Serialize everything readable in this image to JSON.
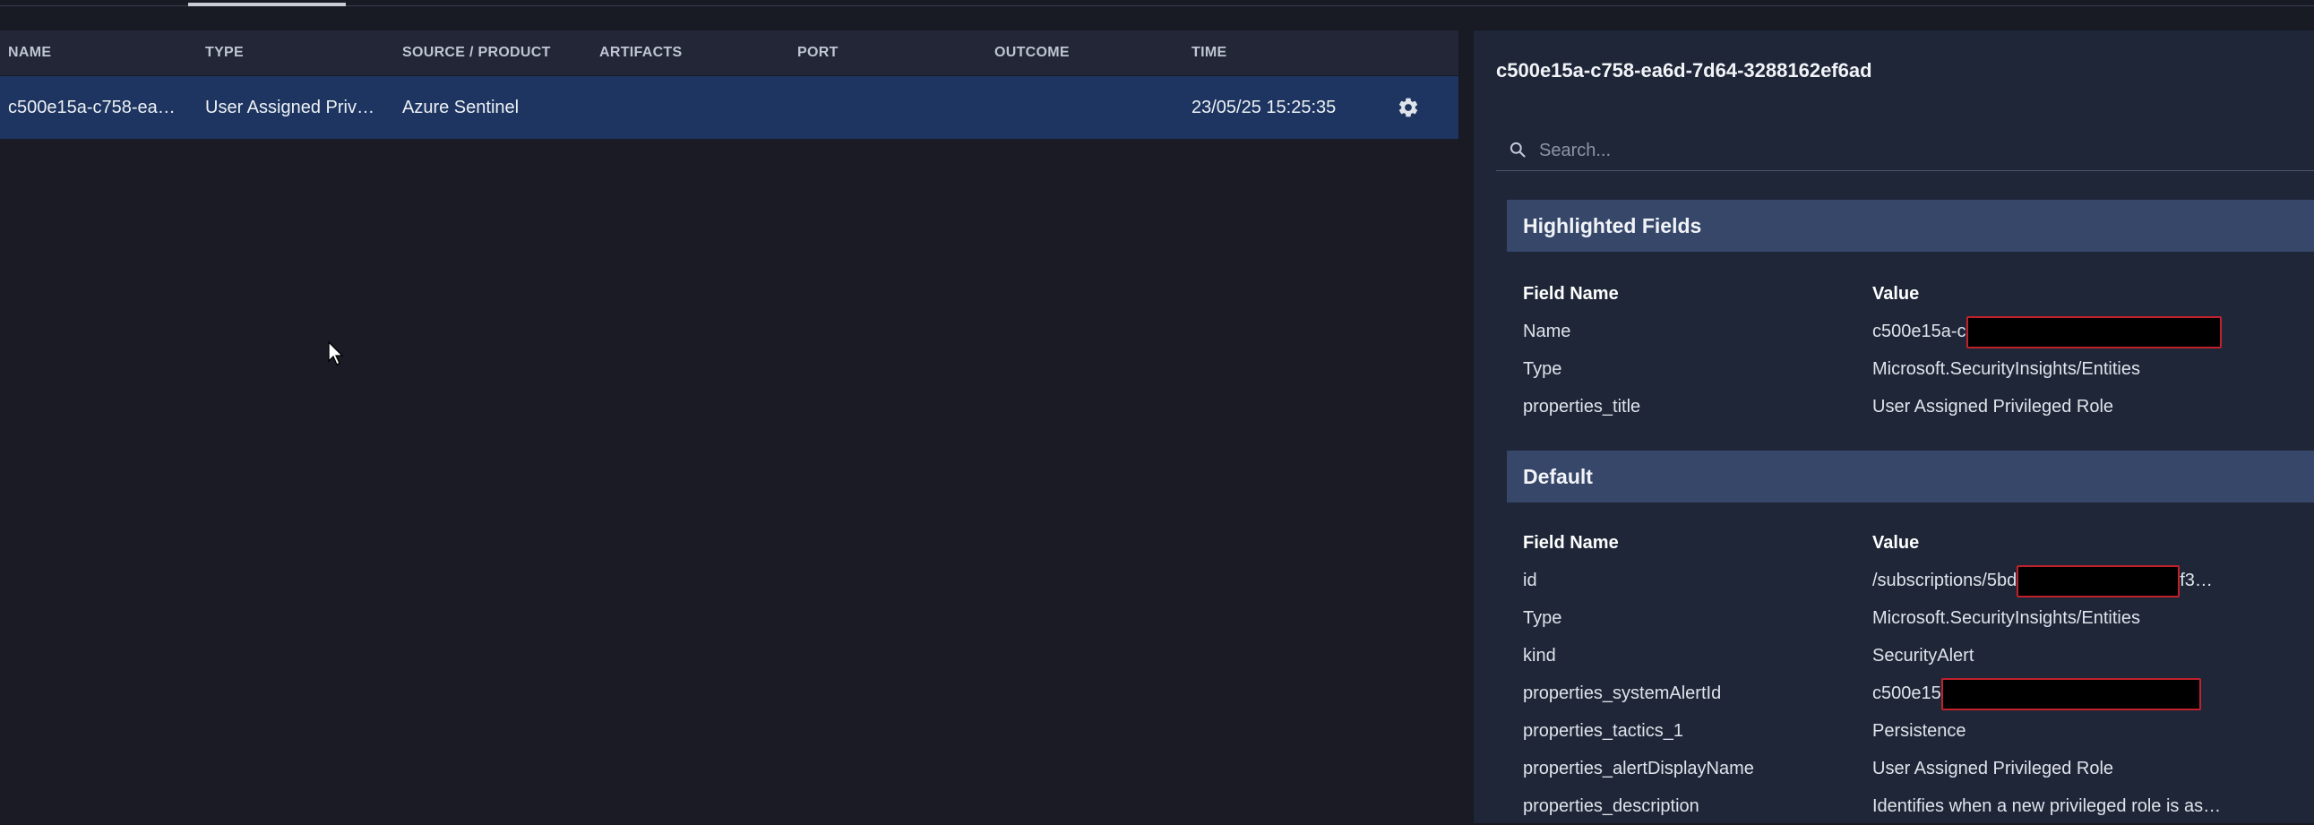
{
  "table": {
    "columns": [
      "NAME",
      "TYPE",
      "SOURCE / PRODUCT",
      "ARTIFACTS",
      "PORT",
      "OUTCOME",
      "TIME"
    ],
    "rows": [
      {
        "name": "c500e15a-c758-ea…",
        "type": "User Assigned Priv…",
        "source": "Azure Sentinel",
        "artifacts": "",
        "port": "",
        "outcome": "",
        "time": "23/05/25 15:25:35"
      }
    ],
    "settings_icon": "gear-icon"
  },
  "detail": {
    "title": "c500e15a-c758-ea6d-7d64-3288162ef6ad",
    "search": {
      "placeholder": "Search...",
      "value": "",
      "icon": "search-icon"
    },
    "sections": [
      {
        "title": "Highlighted Fields",
        "header": {
          "field": "Field Name",
          "value": "Value"
        },
        "rows": [
          {
            "field": "Name",
            "value": "c500e15a-c"
          },
          {
            "field": "Type",
            "value": "Microsoft.SecurityInsights/Entities"
          },
          {
            "field": "properties_title",
            "value": "User Assigned Privileged Role"
          }
        ]
      },
      {
        "title": "Default",
        "header": {
          "field": "Field Name",
          "value": "Value"
        },
        "rows": [
          {
            "field": "id",
            "value": "/subscriptions/5bd",
            "value_suffix": "f3…"
          },
          {
            "field": "Type",
            "value": "Microsoft.SecurityInsights/Entities"
          },
          {
            "field": "kind",
            "value": "SecurityAlert"
          },
          {
            "field": "properties_systemAlertId",
            "value": "c500e15"
          },
          {
            "field": "properties_tactics_1",
            "value": "Persistence"
          },
          {
            "field": "properties_alertDisplayName",
            "value": "User Assigned Privileged Role"
          },
          {
            "field": "properties_description",
            "value": "Identifies when a new privileged role is as…"
          }
        ]
      }
    ]
  }
}
